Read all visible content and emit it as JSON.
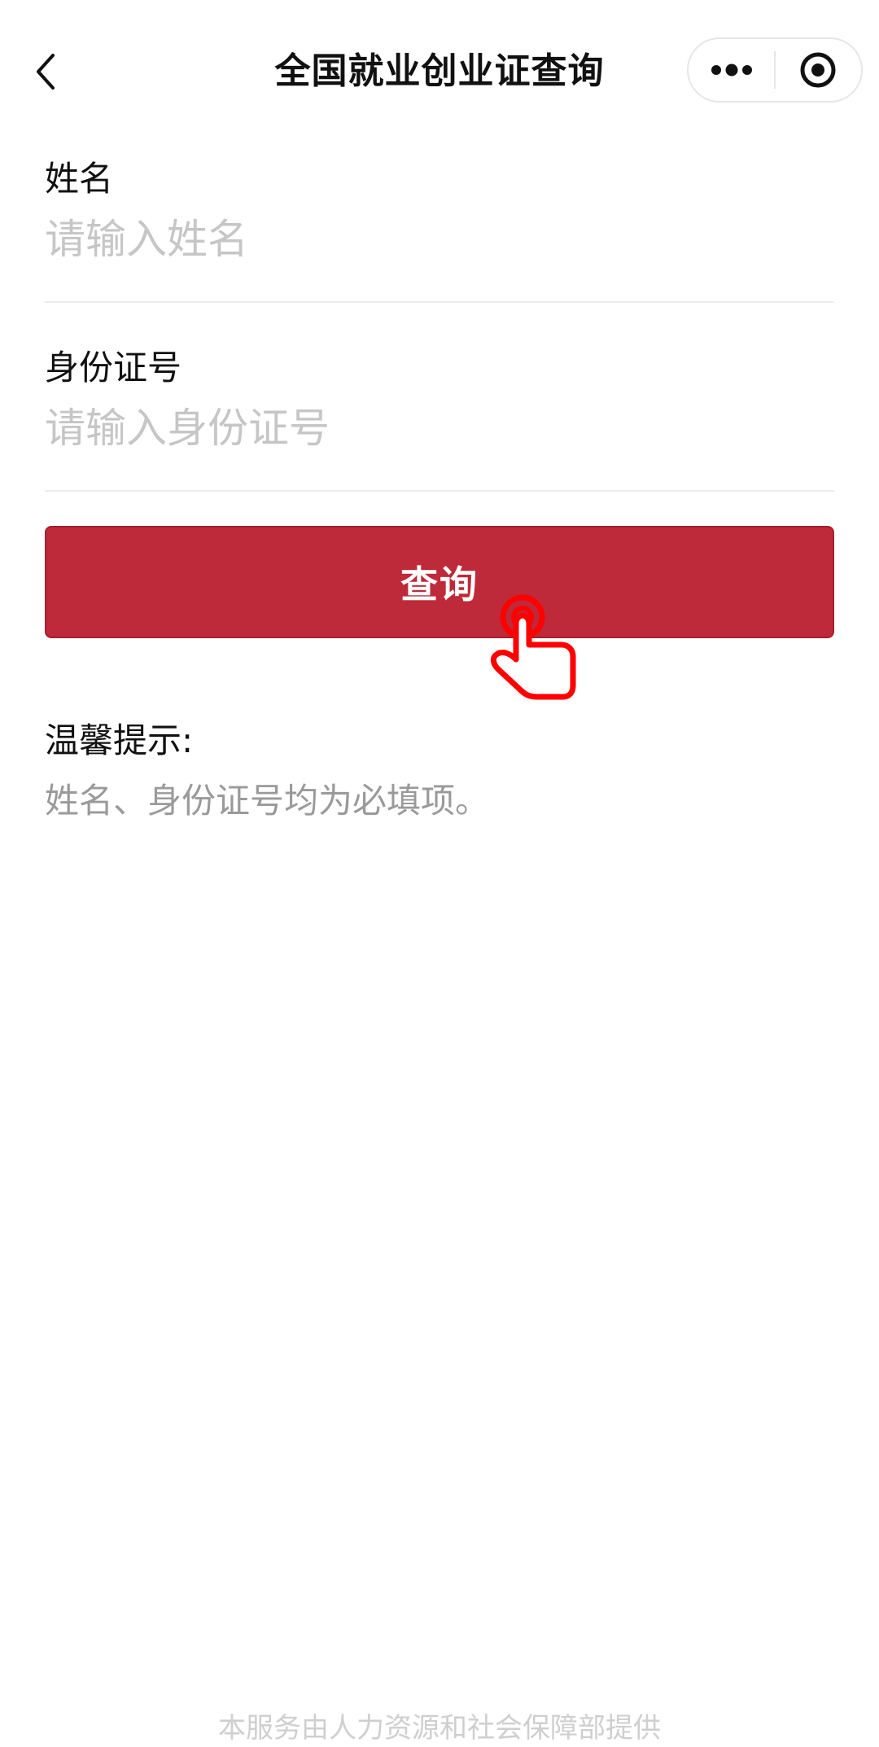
{
  "header": {
    "title": "全国就业创业证查询",
    "back_icon": "chevron-left-icon",
    "more_icon": "more-dots-icon",
    "close_icon": "target-circle-icon"
  },
  "form": {
    "name_label": "姓名",
    "name_placeholder": "请输入姓名",
    "name_value": "",
    "id_label": "身份证号",
    "id_placeholder": "请输入身份证号",
    "id_value": "",
    "query_label": "查询"
  },
  "tips": {
    "title": "温馨提示:",
    "text": "姓名、身份证号均为必填项。"
  },
  "footer": {
    "text": "本服务由人力资源和社会保障部提供"
  },
  "colors": {
    "primary": "#be2a39",
    "placeholder": "#c6c6c6",
    "hint": "#9a9a9a",
    "tap_overlay": "#ff0000"
  }
}
